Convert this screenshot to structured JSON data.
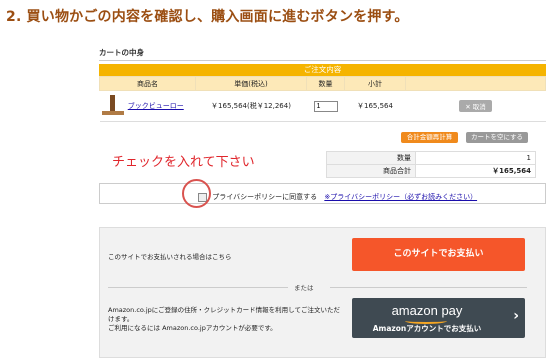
{
  "step": {
    "number": "2.",
    "text": "買い物かごの内容を確認し、購入画面に進むボタンを押す。"
  },
  "cart": {
    "title": "カートの中身",
    "order_header": "ご注文内容",
    "columns": [
      "商品名",
      "単価(税込)",
      "数量",
      "小計"
    ],
    "item": {
      "name": "ブックビューロー",
      "unit_price": "￥165,564(税￥12,264)",
      "quantity": "1",
      "subtotal": "￥165,564",
      "delete_label": "取消",
      "delete_icon": "close-icon"
    },
    "recalc_button": "合計金額再計算",
    "empty_button": "カートを空にする"
  },
  "annotation": "チェックを入れて下さい",
  "summary": {
    "quantity_label": "数量",
    "quantity_value": "1",
    "total_label": "商品合計",
    "total_value": "￥165,564"
  },
  "privacy": {
    "label": "プライバシーポリシーに同意する",
    "link": "※プライバシーポリシー（必ずお読みください）",
    "checked": false
  },
  "payment": {
    "site_pay_desc": "このサイトでお支払いされる場合はこちら",
    "site_pay_button": "このサイトでお支払い",
    "or_text": "または",
    "amazon_desc_1": "Amazon.co.jpにご登録の住所・クレジットカード情報を利用してご注文いただけます。",
    "amazon_desc_2": "ご利用になるには Amazon.co.jpアカウントが必要です。",
    "amazon_logo": "amazon pay",
    "amazon_button_sub": "Amazonアカウントでお支払い",
    "amazon_chevron": "chevron-right-icon"
  },
  "colors": {
    "accent": "#f5b400",
    "title": "#9b4e12",
    "site_pay": "#f5562a",
    "amazon_btn": "#3f4a52",
    "annotation": "#e0262c"
  }
}
